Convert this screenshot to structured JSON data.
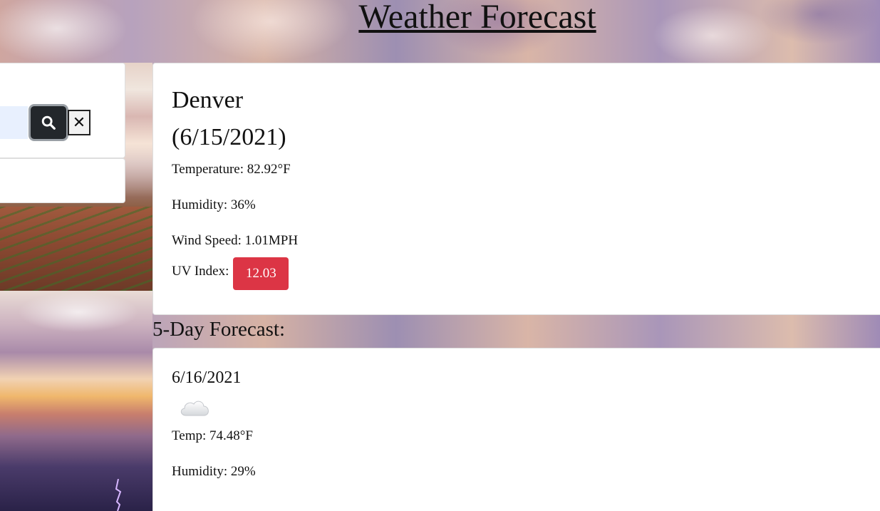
{
  "page": {
    "title": "Weather Forecast"
  },
  "search": {
    "input_value": "",
    "search_icon": "search-icon",
    "clear_label": "✕"
  },
  "current": {
    "city": "Denver",
    "date": "(6/15/2021)",
    "temperature": "Temperature: 82.92°F",
    "humidity": "Humidity: 36%",
    "wind": "Wind Speed: 1.01MPH",
    "uv_label": "UV Index:",
    "uv_value": "12.03",
    "uv_color": "#dc3545"
  },
  "forecast": {
    "heading": "5-Day Forecast:",
    "days": [
      {
        "date": "6/16/2021",
        "icon": "cloud-icon",
        "temp": "Temp: 74.48°F",
        "humidity": "Humidity: 29%"
      }
    ]
  }
}
